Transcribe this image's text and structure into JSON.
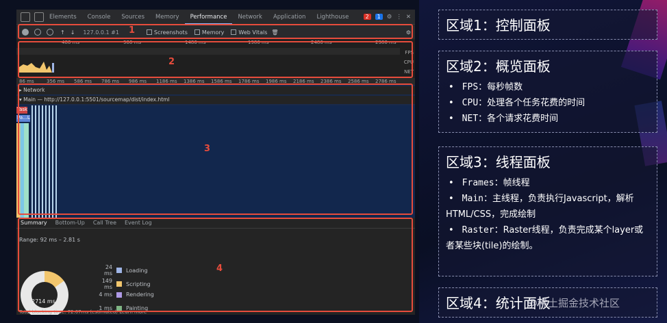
{
  "devtools": {
    "tabs": [
      "Elements",
      "Console",
      "Sources",
      "Memory",
      "Performance",
      "Network",
      "Application",
      "Lighthouse"
    ],
    "active_tab": "Performance",
    "errors": "2",
    "messages": "1",
    "controls": {
      "url": "127.0.0.1 #1",
      "screenshots": "Screenshots",
      "memory": "Memory",
      "web_vitals": "Web Vitals"
    },
    "ruler_top": [
      "486 ms",
      "986 ms",
      "1486 ms",
      "1986 ms",
      "2486 ms",
      "2986 ms"
    ],
    "overview_labels": [
      "FPS",
      "CPU",
      "NET"
    ],
    "ruler_bottom": [
      "86 ms",
      "356 ms",
      "586 ms",
      "786 ms",
      "986 ms",
      "1186 ms",
      "1386 ms",
      "1586 ms",
      "1786 ms",
      "1986 ms",
      "2186 ms",
      "2386 ms",
      "2586 ms",
      "2786 ms"
    ],
    "network_row": "Network",
    "main_row": "Main — http://127.0.0.1:5501/sourcemap/dist/index.html",
    "task_label": "Task",
    "pa_label": "Pa...L",
    "summary_tabs": [
      "Summary",
      "Bottom-Up",
      "Call Tree",
      "Event Log"
    ],
    "range": "Range: 92 ms – 2.81 s",
    "legend": [
      {
        "value": "24 ms",
        "label": "Loading",
        "color": "#9fb5e6"
      },
      {
        "value": "149 ms",
        "label": "Scripting",
        "color": "#f2c66d"
      },
      {
        "value": "4 ms",
        "label": "Rendering",
        "color": "#af9ae6"
      },
      {
        "value": "1 ms",
        "label": "Painting",
        "color": "#80b584"
      }
    ],
    "total": "2714 ms",
    "tbt": "Total blocking time: 72.07ms (estimated)  Learn more"
  },
  "markers": [
    "1",
    "2",
    "3",
    "4"
  ],
  "panels": [
    {
      "title": "区域1：控制面板",
      "items": []
    },
    {
      "title": "区域2：概览面板",
      "items": [
        {
          "code": "FPS",
          "text": "：每秒帧数"
        },
        {
          "code": "CPU",
          "text": "：处理各个任务花费的时间"
        },
        {
          "code": "NET",
          "text": "：各个请求花费时间"
        }
      ]
    },
    {
      "title": "区域3：线程面板",
      "items": [
        {
          "code": "Frames",
          "text": "：帧线程"
        },
        {
          "code": "Main",
          "text": "：主线程，负责执行Javascript，解析HTML/CSS，完成绘制"
        },
        {
          "code": "Raster",
          "text": "：Raster线程，负责完成某个layer或者某些块(tile)的绘制。"
        }
      ]
    },
    {
      "title": "区域4：统计面板",
      "items": []
    }
  ],
  "watermark": "@稀土掘金技术社区"
}
